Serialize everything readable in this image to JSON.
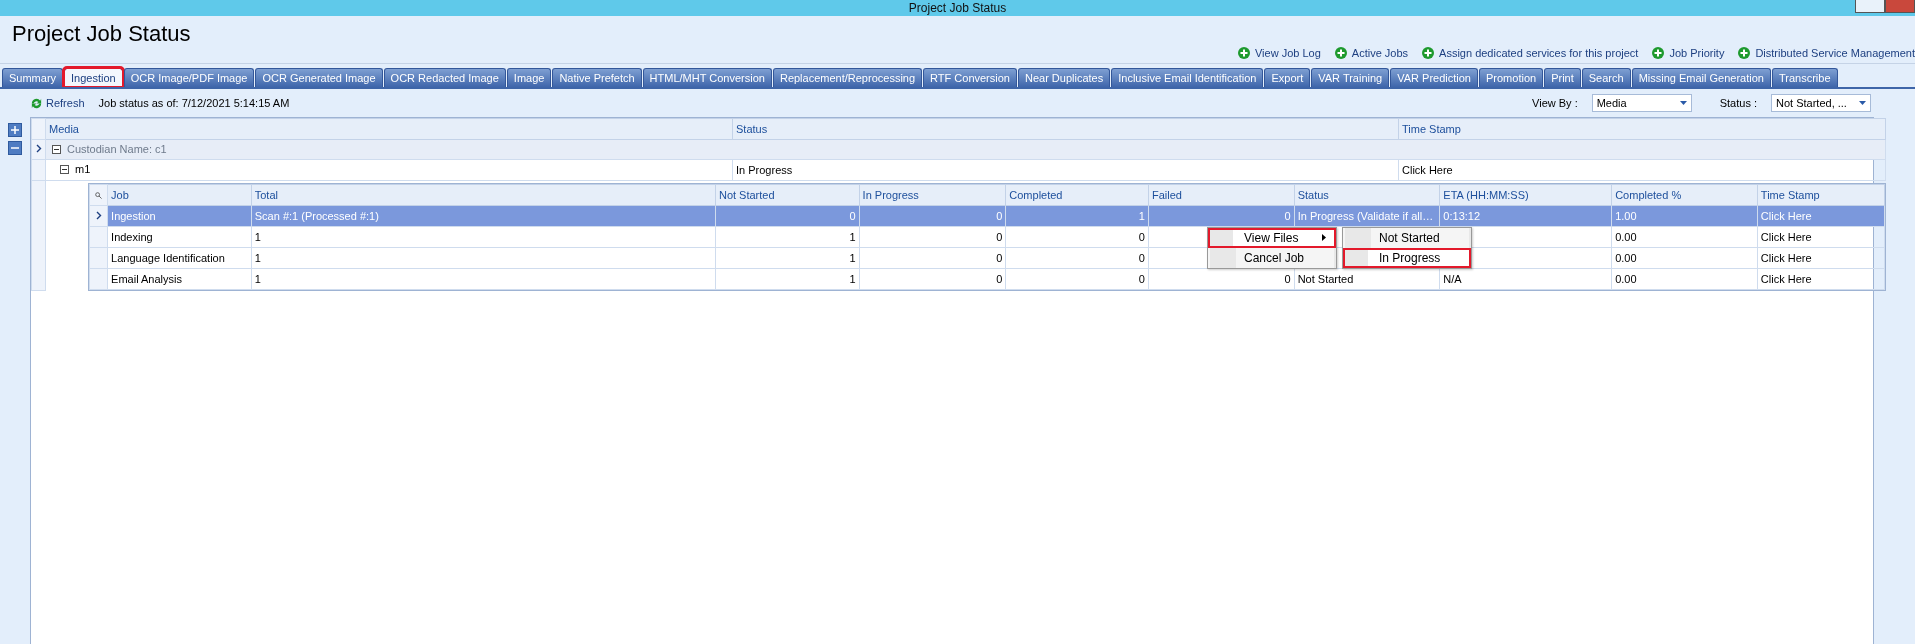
{
  "window": {
    "title": "Project Job Status"
  },
  "header": {
    "title": "Project Job Status"
  },
  "links": [
    "View Job Log",
    "Active Jobs",
    "Assign dedicated services for this project",
    "Job Priority",
    "Distributed Service Management"
  ],
  "tabs": [
    {
      "label": "Summary",
      "selected": false,
      "highlighted": false
    },
    {
      "label": "Ingestion",
      "selected": true,
      "highlighted": true
    },
    {
      "label": "OCR Image/PDF Image",
      "selected": false,
      "highlighted": false
    },
    {
      "label": "OCR Generated Image",
      "selected": false,
      "highlighted": false
    },
    {
      "label": "OCR Redacted Image",
      "selected": false,
      "highlighted": false
    },
    {
      "label": "Image",
      "selected": false,
      "highlighted": false
    },
    {
      "label": "Native Prefetch",
      "selected": false,
      "highlighted": false
    },
    {
      "label": "HTML/MHT Conversion",
      "selected": false,
      "highlighted": false
    },
    {
      "label": "Replacement/Reprocessing",
      "selected": false,
      "highlighted": false
    },
    {
      "label": "RTF Conversion",
      "selected": false,
      "highlighted": false
    },
    {
      "label": "Near Duplicates",
      "selected": false,
      "highlighted": false
    },
    {
      "label": "Inclusive Email Identification",
      "selected": false,
      "highlighted": false
    },
    {
      "label": "Export",
      "selected": false,
      "highlighted": false
    },
    {
      "label": "VAR Training",
      "selected": false,
      "highlighted": false
    },
    {
      "label": "VAR Prediction",
      "selected": false,
      "highlighted": false
    },
    {
      "label": "Promotion",
      "selected": false,
      "highlighted": false
    },
    {
      "label": "Print",
      "selected": false,
      "highlighted": false
    },
    {
      "label": "Search",
      "selected": false,
      "highlighted": false
    },
    {
      "label": "Missing Email Generation",
      "selected": false,
      "highlighted": false
    },
    {
      "label": "Transcribe",
      "selected": false,
      "highlighted": false
    }
  ],
  "toolbar": {
    "refresh": "Refresh",
    "status_text": "Job status as of: 7/12/2021 5:14:15 AM",
    "view_by": {
      "label": "View By :",
      "value": "Media"
    },
    "status_filter": {
      "label": "Status :",
      "value": "Not Started, ..."
    }
  },
  "grid": {
    "columns": [
      "Media",
      "Status",
      "Time Stamp"
    ],
    "groups": [
      {
        "label": "Custodian Name: c1",
        "expanded": true,
        "rows": [
          {
            "media": "m1",
            "status": "In Progress",
            "time_stamp": "Click Here",
            "expanded": true,
            "jobs": {
              "columns": [
                "Job",
                "Total",
                "Not Started",
                "In Progress",
                "Completed",
                "Failed",
                "Status",
                "ETA (HH:MM:SS)",
                "Completed %",
                "Time Stamp"
              ],
              "rows": [
                {
                  "selected": true,
                  "cells": [
                    "Ingestion",
                    "Scan #:1 (Processed #:1)",
                    "0",
                    "0",
                    "1",
                    "0",
                    "In Progress (Validate if all…",
                    "0:13:12",
                    "1.00",
                    "Click Here"
                  ]
                },
                {
                  "selected": false,
                  "cells": [
                    "Indexing",
                    "1",
                    "1",
                    "0",
                    "0",
                    null,
                    null,
                    null,
                    "0.00",
                    "Click Here"
                  ]
                },
                {
                  "selected": false,
                  "cells": [
                    "Language Identification",
                    "1",
                    "1",
                    "0",
                    "0",
                    null,
                    null,
                    null,
                    "0.00",
                    "Click Here"
                  ]
                },
                {
                  "selected": false,
                  "cells": [
                    "Email Analysis",
                    "1",
                    "1",
                    "0",
                    "0",
                    "0",
                    "Not Started",
                    "N/A",
                    "0.00",
                    "Click Here"
                  ]
                }
              ]
            }
          }
        ]
      }
    ]
  },
  "context_menu": {
    "items": [
      {
        "label": "View Files",
        "highlighted": true,
        "has_submenu": true
      },
      {
        "label": "Cancel Job",
        "highlighted": false,
        "has_submenu": false
      }
    ],
    "submenu": {
      "items": [
        {
          "label": "Not Started",
          "highlighted": false
        },
        {
          "label": "In Progress",
          "highlighted": true
        }
      ]
    }
  }
}
